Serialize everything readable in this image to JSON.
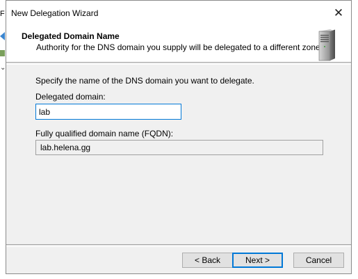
{
  "background": {
    "fragment": "F"
  },
  "dialog": {
    "title": "New Delegation Wizard",
    "close_label": "✕",
    "header": {
      "title": "Delegated Domain Name",
      "subtitle": "Authority for the DNS domain you supply will be delegated to a different zone.",
      "icon": "server-icon"
    },
    "body": {
      "instruction": "Specify the name of the DNS domain you want to delegate.",
      "delegated_domain_label": "Delegated domain:",
      "delegated_domain_value": "lab",
      "fqdn_label": "Fully qualified domain name (FQDN):",
      "fqdn_value": "lab.helena.gg"
    },
    "buttons": {
      "back": "< Back",
      "next": "Next >",
      "cancel": "Cancel"
    }
  },
  "colors": {
    "accent": "#0078d7",
    "dialog_bg": "#f0f0f0"
  }
}
